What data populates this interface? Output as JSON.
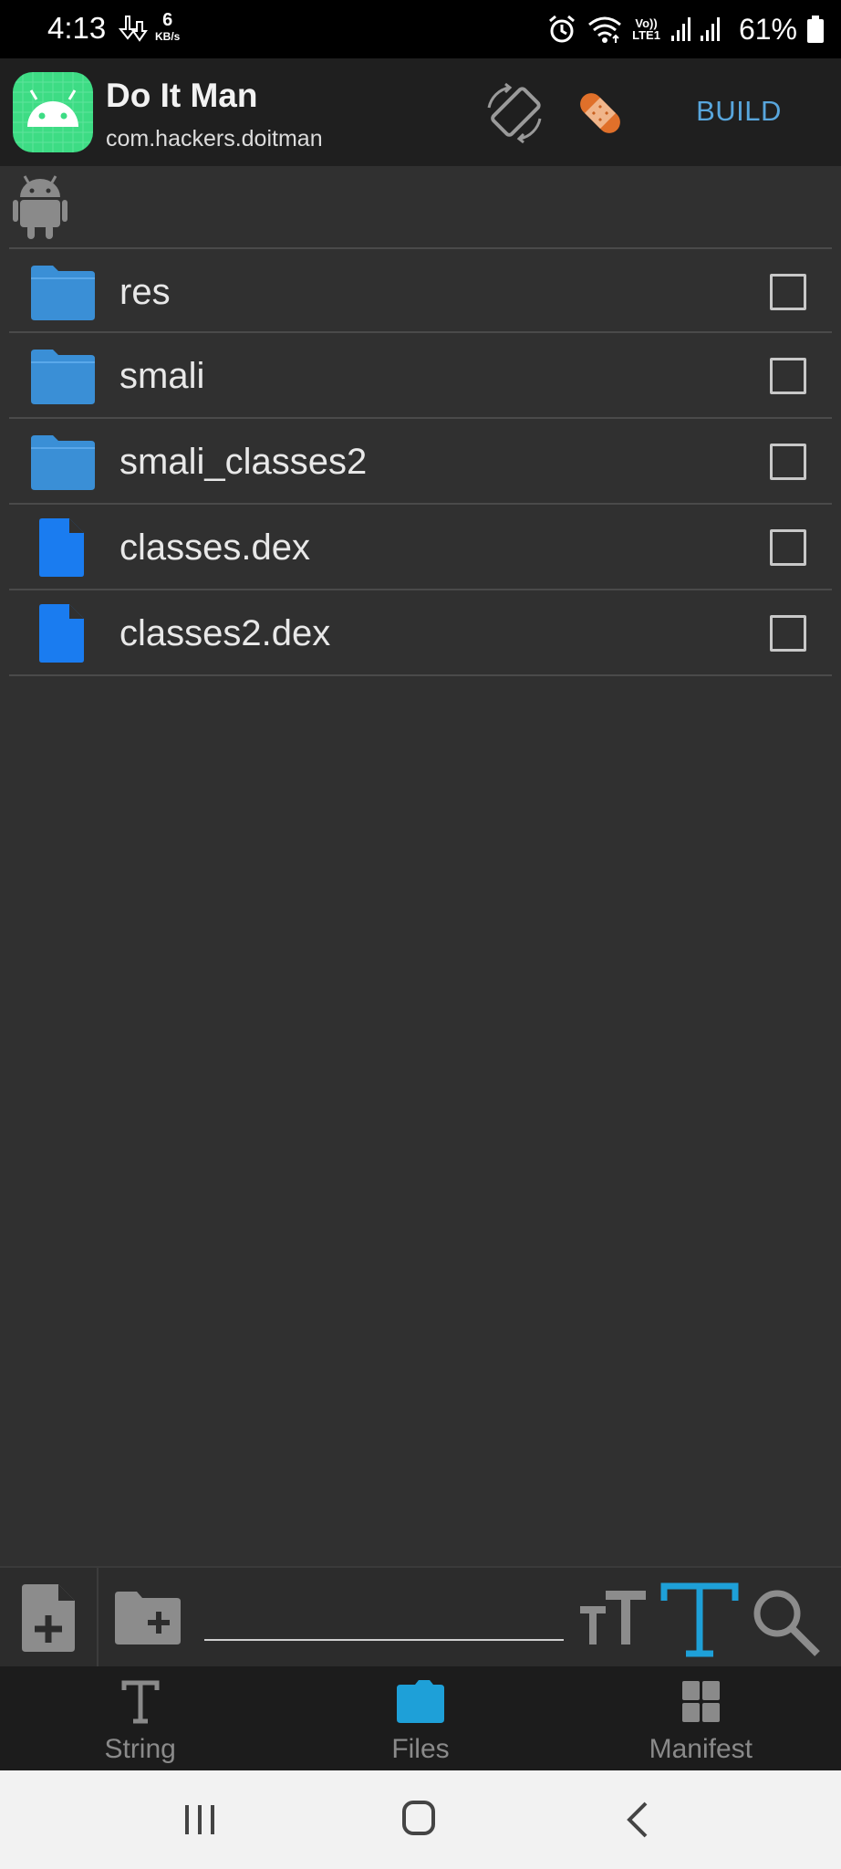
{
  "status_bar": {
    "time": "4:13",
    "net_speed_value": "6",
    "net_speed_unit": "KB/s",
    "volte_label": "Vo))",
    "lte_label": "LTE1",
    "battery_percent": "61%",
    "icons": [
      "download-icon",
      "alarm-icon",
      "wifi-icon",
      "signal-icon",
      "battery-icon"
    ]
  },
  "app_bar": {
    "title": "Do It Man",
    "package": "com.hackers.doitman",
    "build_label": "BUILD",
    "icons": [
      "android-app-icon",
      "rotate-screen-icon",
      "patch-icon"
    ],
    "accent_color": "#58a6dd"
  },
  "path_bar": {
    "icon": "android-icon"
  },
  "files": [
    {
      "name": "res",
      "type": "folder",
      "checked": false
    },
    {
      "name": "smali",
      "type": "folder",
      "checked": false
    },
    {
      "name": "smali_classes2",
      "type": "folder",
      "checked": false
    },
    {
      "name": "classes.dex",
      "type": "file",
      "checked": false
    },
    {
      "name": "classes2.dex",
      "type": "file",
      "checked": false
    }
  ],
  "toolbar": {
    "filter_value": "",
    "icons": [
      "new-file-icon",
      "new-folder-icon",
      "text-size-icon",
      "font-icon",
      "search-icon"
    ]
  },
  "bottom_nav": {
    "items": [
      {
        "label": "String",
        "icon": "string-icon",
        "active": false
      },
      {
        "label": "Files",
        "icon": "folder-icon",
        "active": true
      },
      {
        "label": "Manifest",
        "icon": "manifest-icon",
        "active": false
      }
    ]
  },
  "system_nav": {
    "icons": [
      "recent-apps-icon",
      "home-icon",
      "back-icon"
    ]
  },
  "colors": {
    "background": "#303030",
    "folder_blue": "#3a8fd6",
    "file_blue": "#1a7cf0",
    "active_tab": "#1ea0d8"
  }
}
